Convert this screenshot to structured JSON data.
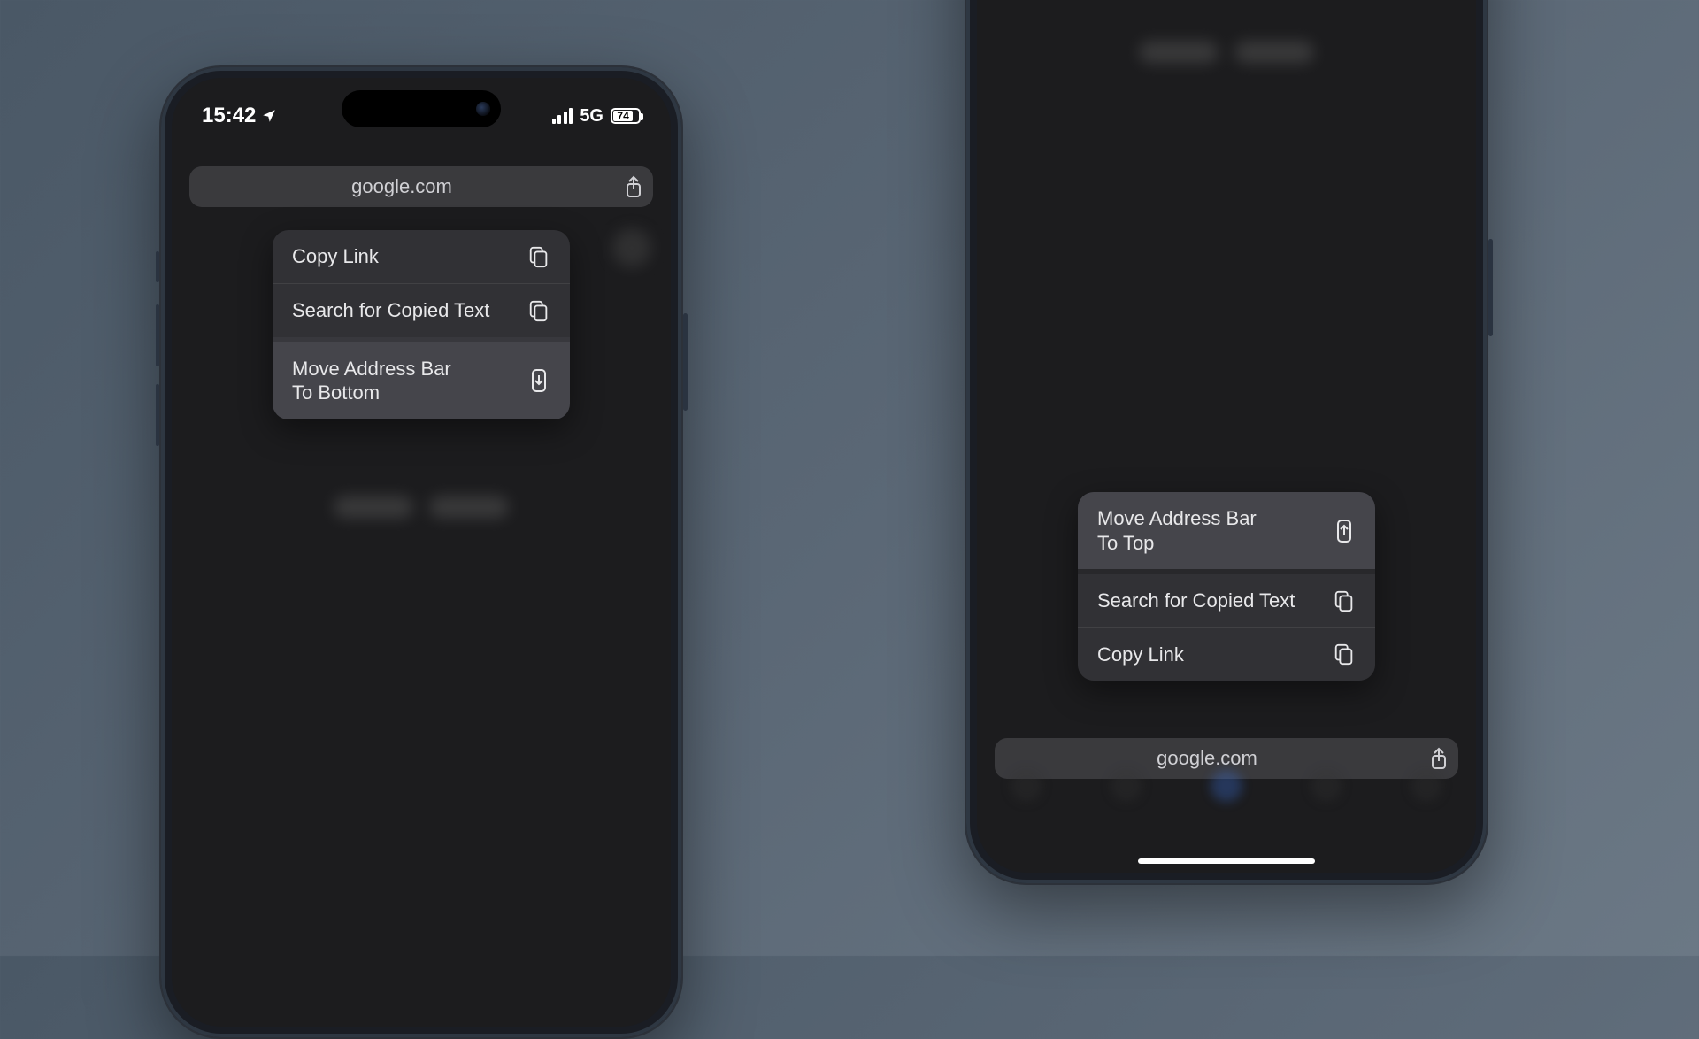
{
  "left_phone": {
    "status": {
      "time": "15:42",
      "network_label": "5G",
      "battery_percent": "74"
    },
    "address_bar": {
      "url": "google.com"
    },
    "menu": {
      "items": [
        {
          "label": "Copy Link",
          "icon": "copy-doc"
        },
        {
          "label": "Search for Copied Text",
          "icon": "clipboard-search"
        },
        {
          "label": "Move Address Bar\nTo Bottom",
          "icon": "phone-arrow-down"
        }
      ]
    }
  },
  "right_phone": {
    "address_bar": {
      "url": "google.com"
    },
    "menu": {
      "items": [
        {
          "label": "Move Address Bar\nTo Top",
          "icon": "phone-arrow-up"
        },
        {
          "label": "Search for Copied Text",
          "icon": "clipboard-search"
        },
        {
          "label": "Copy Link",
          "icon": "copy-doc"
        }
      ]
    }
  },
  "colors": {
    "menu_bg": "#323236",
    "menu_highlight": "#4e4e56",
    "addr_bg": "#4a4a52"
  }
}
